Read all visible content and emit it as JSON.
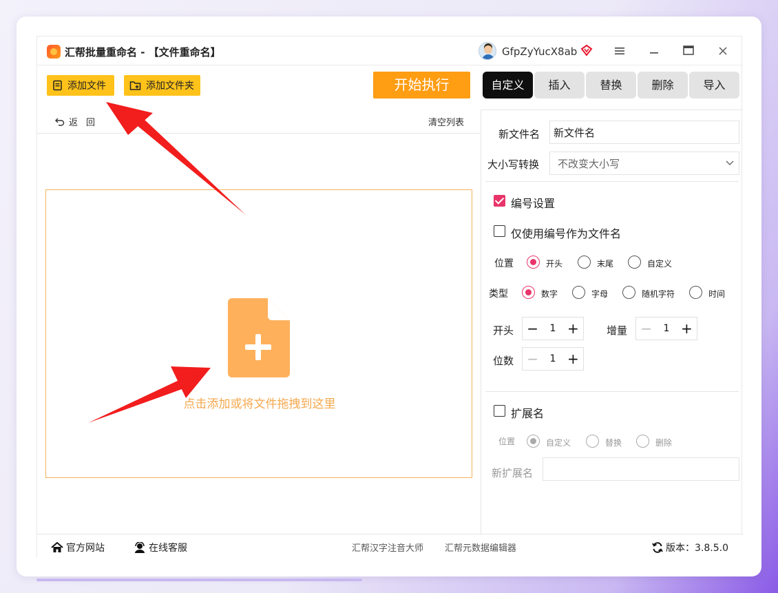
{
  "app": {
    "title": "汇帮批量重命名 - 【文件重命名】",
    "username": "GfpZyYucX8ab"
  },
  "toolbar": {
    "add_file": "添加文件",
    "add_folder": "添加文件夹",
    "start": "开始执行"
  },
  "tabs": [
    {
      "label": "自定义",
      "active": true
    },
    {
      "label": "插入"
    },
    {
      "label": "替换"
    },
    {
      "label": "删除"
    },
    {
      "label": "导入"
    }
  ],
  "list": {
    "back": "返回",
    "clear": "清空列表",
    "drop_hint": "点击添加或将文件拖拽到这里"
  },
  "settings": {
    "new_name_label": "新文件名",
    "new_name_value": "新文件名",
    "case_label": "大小写转换",
    "case_value": "不改变大小写",
    "numbering_label": "编号设置",
    "numbering_checked": true,
    "only_number_label": "仅使用编号作为文件名",
    "only_number_checked": false,
    "position_label": "位置",
    "position_options": [
      "开头",
      "末尾",
      "自定义"
    ],
    "position_selected": "开头",
    "type_label": "类型",
    "type_options": [
      "数字",
      "字母",
      "随机字符",
      "时间"
    ],
    "type_selected": "数字",
    "start_label": "开头",
    "start_value": "1",
    "increment_label": "增量",
    "increment_value": "1",
    "digits_label": "位数",
    "digits_value": "1",
    "ext_label": "扩展名",
    "ext_checked": false,
    "ext_position_label": "位置",
    "ext_position_options": [
      "自定义",
      "替换",
      "删除"
    ],
    "ext_position_selected": "自定义",
    "new_ext_label": "新扩展名",
    "new_ext_value": ""
  },
  "footer": {
    "website": "官方网站",
    "support": "在线客服",
    "link1": "汇帮汉字注音大师",
    "link2": "汇帮元数据编辑器",
    "version": "版本：3.8.5.0"
  },
  "colors": {
    "accent": "#e8346a",
    "primary_orange": "#ff9d13",
    "add_button_yellow": "#ffc21a",
    "drop_border": "#f5b35a",
    "drop_icon": "#ffb05a"
  }
}
